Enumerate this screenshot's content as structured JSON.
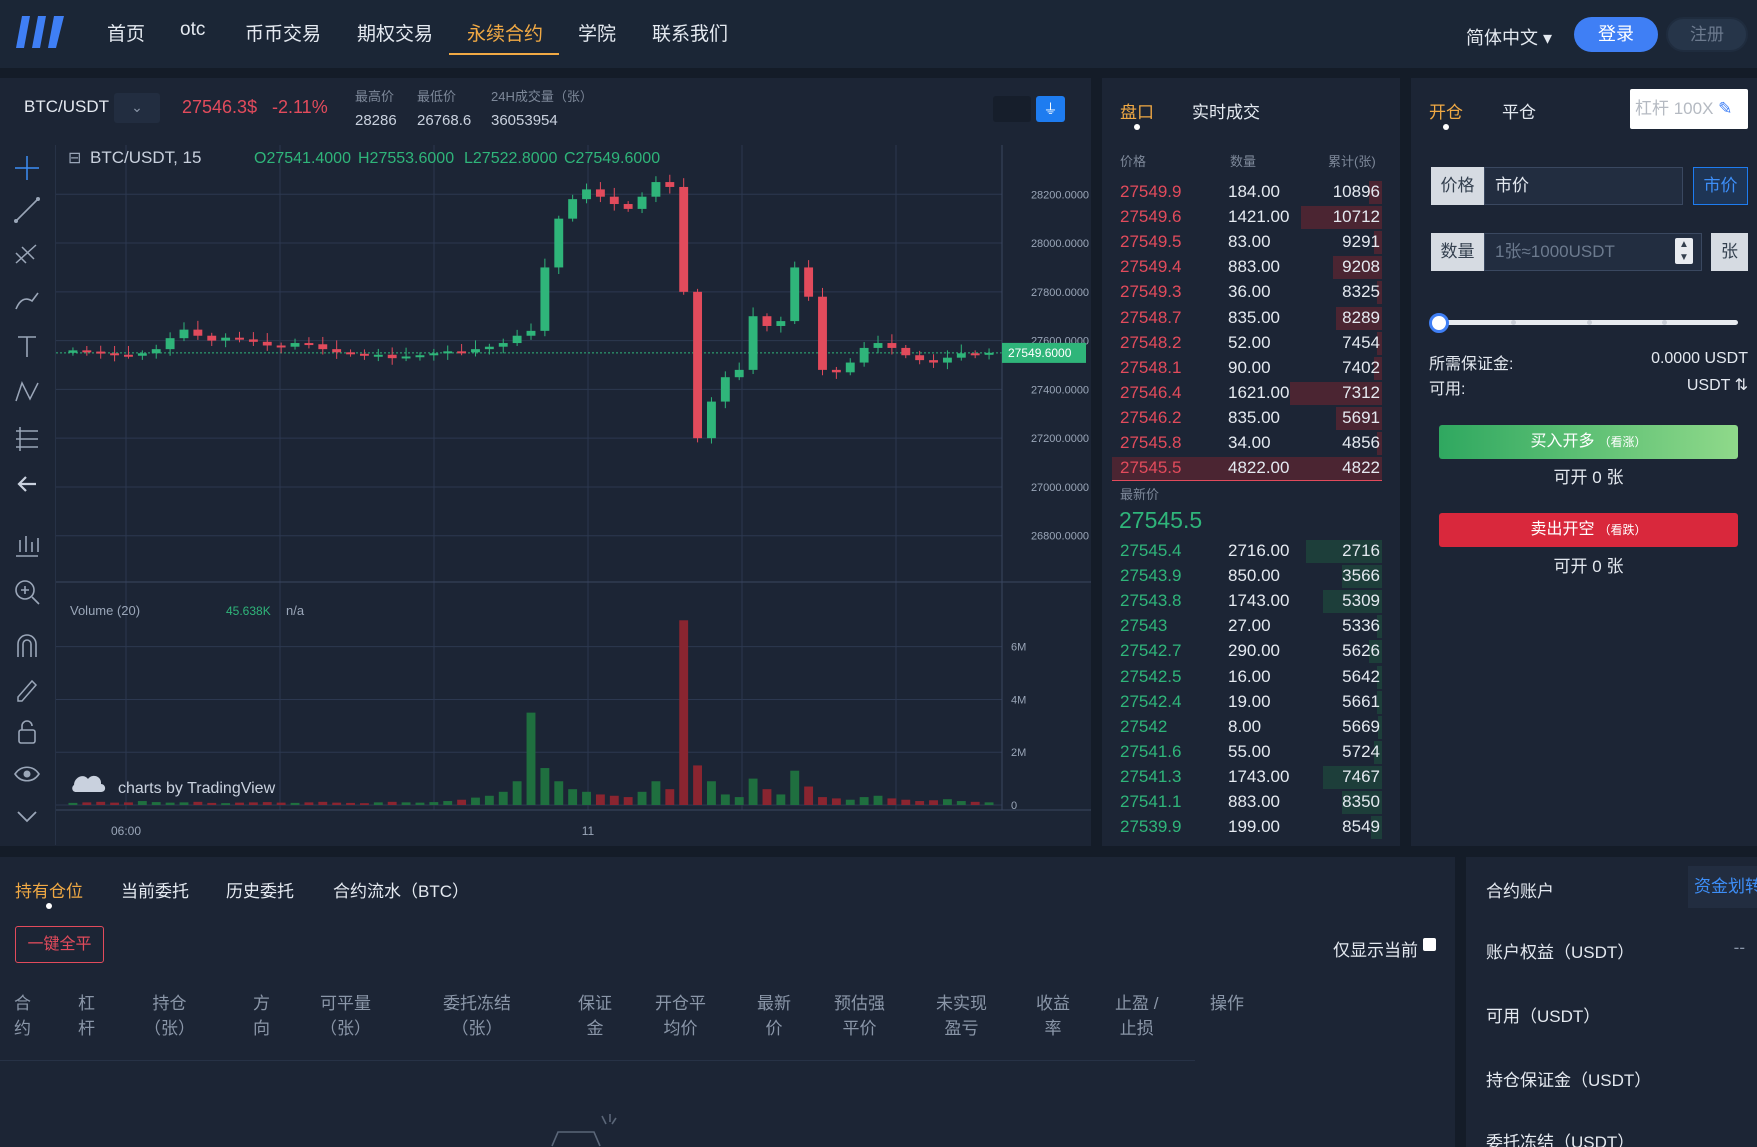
{
  "nav": {
    "items": [
      "首页",
      "otc",
      "币币交易",
      "期权交易",
      "永续合约",
      "学院",
      "联系我们"
    ],
    "active_index": 4,
    "language": "简体中文",
    "login": "登录",
    "register": "注册"
  },
  "ticker": {
    "pair": "BTC/USDT",
    "last_price": "27546.3$",
    "change": "-2.11%",
    "high_label": "最高价",
    "high": "28286",
    "low_label": "最低价",
    "low": "26768.6",
    "volume_label": "24H成交量（张）",
    "volume": "36053954"
  },
  "chart": {
    "legend_symbol": "BTC/USDT, 15",
    "legend_o": "O27541.4000",
    "legend_h": "H27553.6000",
    "legend_l": "L27522.8000",
    "legend_c": "C27549.6000",
    "volume_legend": "Volume (20)",
    "volume_value": "45.638K",
    "volume_na": "n/a",
    "watermark": "charts by TradingView",
    "current_price_tag": "27549.6000",
    "time_labels": [
      "06:00",
      "11"
    ]
  },
  "chart_data": {
    "type": "candlestick",
    "title": "BTC/USDT, 15",
    "y_ticks": [
      "28200.0000",
      "28000.0000",
      "27800.0000",
      "27600.0000",
      "27400.0000",
      "27200.0000",
      "27000.0000",
      "26800.0000"
    ],
    "ylim": [
      26680,
      28320
    ],
    "volume_ticks": [
      "6M",
      "4M",
      "2M",
      "0"
    ],
    "volume_ylim": [
      0,
      7200000
    ],
    "x_ticks": [
      "06:00",
      "11"
    ],
    "last_price": 27549.6,
    "close_series": [
      27560,
      27555,
      27548,
      27542,
      27538,
      27548,
      27565,
      27610,
      27645,
      27620,
      27600,
      27612,
      27605,
      27595,
      27580,
      27575,
      27590,
      27585,
      27565,
      27552,
      27546,
      27538,
      27542,
      27528,
      27535,
      27540,
      27548,
      27556,
      27552,
      27565,
      27575,
      27590,
      27620,
      27640,
      27900,
      28100,
      28180,
      28220,
      28190,
      28160,
      28140,
      28190,
      28250,
      28230,
      27800,
      27200,
      27350,
      27450,
      27480,
      27700,
      27660,
      27680,
      27900,
      27780,
      27480,
      27470,
      27510,
      27570,
      27590,
      27570,
      27540,
      27520,
      27510,
      27530,
      27548,
      27545,
      27550
    ],
    "volume_series": [
      0.08,
      0.1,
      0.12,
      0.09,
      0.1,
      0.15,
      0.11,
      0.09,
      0.1,
      0.12,
      0.08,
      0.07,
      0.09,
      0.1,
      0.11,
      0.09,
      0.08,
      0.1,
      0.12,
      0.09,
      0.08,
      0.07,
      0.1,
      0.12,
      0.1,
      0.09,
      0.11,
      0.15,
      0.2,
      0.28,
      0.35,
      0.5,
      0.9,
      3.5,
      1.4,
      0.9,
      0.6,
      0.5,
      0.4,
      0.35,
      0.3,
      0.5,
      0.9,
      0.6,
      7.0,
      1.5,
      0.9,
      0.4,
      0.3,
      1.0,
      0.6,
      0.4,
      1.3,
      0.7,
      0.3,
      0.25,
      0.2,
      0.3,
      0.35,
      0.25,
      0.2,
      0.15,
      0.18,
      0.22,
      0.15,
      0.12,
      0.1
    ]
  },
  "orderbook": {
    "tab_active": "盘口",
    "tab_trades": "实时成交",
    "col_price": "价格",
    "col_qty": "数量",
    "col_cum": "累计(张)",
    "asks": [
      {
        "price": "27549.9",
        "qty": "184.00",
        "cum": "10896",
        "depth": 0.05
      },
      {
        "price": "27549.6",
        "qty": "1421.00",
        "cum": "10712",
        "depth": 0.3
      },
      {
        "price": "27549.5",
        "qty": "83.00",
        "cum": "9291",
        "depth": 0.03
      },
      {
        "price": "27549.4",
        "qty": "883.00",
        "cum": "9208",
        "depth": 0.18
      },
      {
        "price": "27549.3",
        "qty": "36.00",
        "cum": "8325",
        "depth": 0.02
      },
      {
        "price": "27548.7",
        "qty": "835.00",
        "cum": "8289",
        "depth": 0.17
      },
      {
        "price": "27548.2",
        "qty": "52.00",
        "cum": "7454",
        "depth": 0.02
      },
      {
        "price": "27548.1",
        "qty": "90.00",
        "cum": "7402",
        "depth": 0.03
      },
      {
        "price": "27546.4",
        "qty": "1621.00",
        "cum": "7312",
        "depth": 0.34
      },
      {
        "price": "27546.2",
        "qty": "835.00",
        "cum": "5691",
        "depth": 0.17
      },
      {
        "price": "27545.8",
        "qty": "34.00",
        "cum": "4856",
        "depth": 0.02
      },
      {
        "price": "27545.5",
        "qty": "4822.00",
        "cum": "4822",
        "depth": 1.0
      }
    ],
    "latest_label": "最新价",
    "latest_price": "27545.5",
    "bids": [
      {
        "price": "27545.4",
        "qty": "2716.00",
        "cum": "2716",
        "depth": 0.28
      },
      {
        "price": "27543.9",
        "qty": "850.00",
        "cum": "3566",
        "depth": 0.15
      },
      {
        "price": "27543.8",
        "qty": "1743.00",
        "cum": "5309",
        "depth": 0.22
      },
      {
        "price": "27543",
        "qty": "27.00",
        "cum": "5336",
        "depth": 0.02
      },
      {
        "price": "27542.7",
        "qty": "290.00",
        "cum": "5626",
        "depth": 0.05
      },
      {
        "price": "27542.5",
        "qty": "16.00",
        "cum": "5642",
        "depth": 0.02
      },
      {
        "price": "27542.4",
        "qty": "19.00",
        "cum": "5661",
        "depth": 0.02
      },
      {
        "price": "27542",
        "qty": "8.00",
        "cum": "5669",
        "depth": 0.01
      },
      {
        "price": "27541.6",
        "qty": "55.00",
        "cum": "5724",
        "depth": 0.03
      },
      {
        "price": "27541.3",
        "qty": "1743.00",
        "cum": "7467",
        "depth": 0.22
      },
      {
        "price": "27541.1",
        "qty": "883.00",
        "cum": "8350",
        "depth": 0.15
      },
      {
        "price": "27539.9",
        "qty": "199.00",
        "cum": "8549",
        "depth": 0.04
      }
    ]
  },
  "trade": {
    "tab_open": "开仓",
    "tab_close": "平仓",
    "leverage": "杠杆 100X",
    "price_label": "价格",
    "price_value": "市价",
    "market_btn": "市价",
    "qty_label": "数量",
    "qty_placeholder": "1张≈1000USDT",
    "unit": "张",
    "slider_value": 0,
    "margin_label": "所需保证金:",
    "margin_value": "0.0000 USDT",
    "available_label": "可用:",
    "available_value": "USDT ⇅",
    "buy_label": "买入开多",
    "buy_sub": "（看涨）",
    "buy_count": "可开 0 张",
    "sell_label": "卖出开空",
    "sell_sub": "（看跌）",
    "sell_count": "可开 0 张"
  },
  "positions": {
    "tabs": [
      "持有仓位",
      "当前委托",
      "历史委托",
      "合约流水（BTC）"
    ],
    "close_all": "一键全平",
    "show_current": "仅显示当前",
    "columns": [
      [
        "合",
        "约"
      ],
      [
        "杠",
        "杆"
      ],
      [
        "持仓",
        "（张）"
      ],
      [
        "方",
        "向"
      ],
      [
        "可平量",
        "（张）"
      ],
      [
        "委托冻结",
        "（张）"
      ],
      [
        "保证",
        "金"
      ],
      [
        "开仓平",
        "均价"
      ],
      [
        "最新",
        "价"
      ],
      [
        "预估强",
        "平价"
      ],
      [
        "未实现",
        "盈亏"
      ],
      [
        "收益",
        "率"
      ],
      [
        "止盈 /",
        "止损"
      ],
      [
        "",
        "操作"
      ]
    ]
  },
  "account": {
    "title": "合约账户",
    "transfer": "资金划转",
    "equity_label": "账户权益（USDT）",
    "equity_value": "--",
    "available_label": "可用（USDT）",
    "margin_label": "持仓保证金（USDT）",
    "frozen_label": "委托冻结（USDT）"
  },
  "colors": {
    "up": "#2fb57a",
    "down": "#e24b5c",
    "accent": "#f0a944",
    "primary": "#3f7ff5"
  }
}
